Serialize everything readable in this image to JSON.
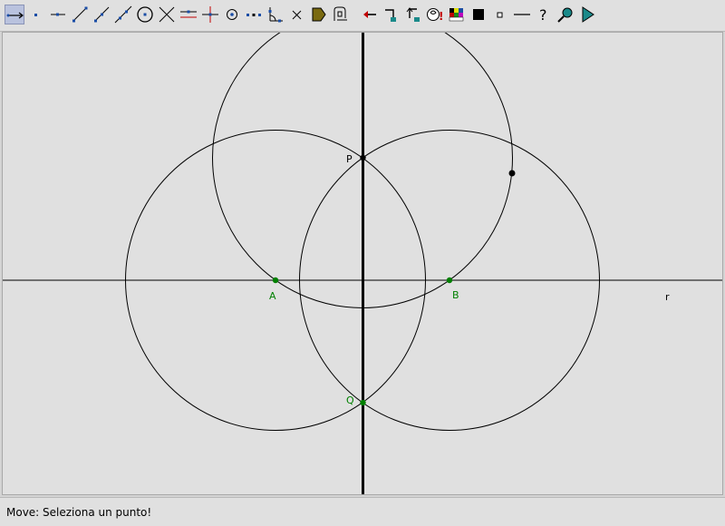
{
  "toolbar": {
    "tools": [
      {
        "name": "move-tool-icon",
        "active": true
      },
      {
        "name": "point-tool-icon"
      },
      {
        "name": "point-on-object-tool-icon"
      },
      {
        "name": "segment-tool-icon"
      },
      {
        "name": "ray-tool-icon"
      },
      {
        "name": "line-tool-icon"
      },
      {
        "name": "circle-tool-icon"
      },
      {
        "name": "intersection-tool-icon"
      },
      {
        "name": "parallel-line-tool-icon"
      },
      {
        "name": "perpendicular-line-tool-icon"
      },
      {
        "name": "midpoint-tool-icon"
      },
      {
        "name": "dotted-tool-icon"
      },
      {
        "name": "angle-tool-icon"
      },
      {
        "name": "delete-tool-icon"
      },
      {
        "name": "label-tool-icon"
      },
      {
        "name": "text-tool-icon"
      },
      {
        "name": "undo-tool-icon"
      },
      {
        "name": "macro-tool-icon"
      },
      {
        "name": "macro-run-tool-icon"
      },
      {
        "name": "hint-tool-icon"
      },
      {
        "name": "color-tool-icon"
      },
      {
        "name": "fill-tool-icon"
      },
      {
        "name": "point-size-tool-icon"
      },
      {
        "name": "line-style-tool-icon"
      },
      {
        "name": "help-tool-icon"
      },
      {
        "name": "zoom-tool-icon"
      },
      {
        "name": "play-tool-icon"
      }
    ]
  },
  "canvas": {
    "labels": {
      "A": "A",
      "B": "B",
      "P": "P",
      "Q": "Q",
      "r": "r"
    },
    "colors": {
      "stroke": "#000000",
      "green_point": "#008000",
      "background": "#e0e0e0"
    }
  },
  "status": {
    "text": "Move: Seleziona un punto!"
  }
}
